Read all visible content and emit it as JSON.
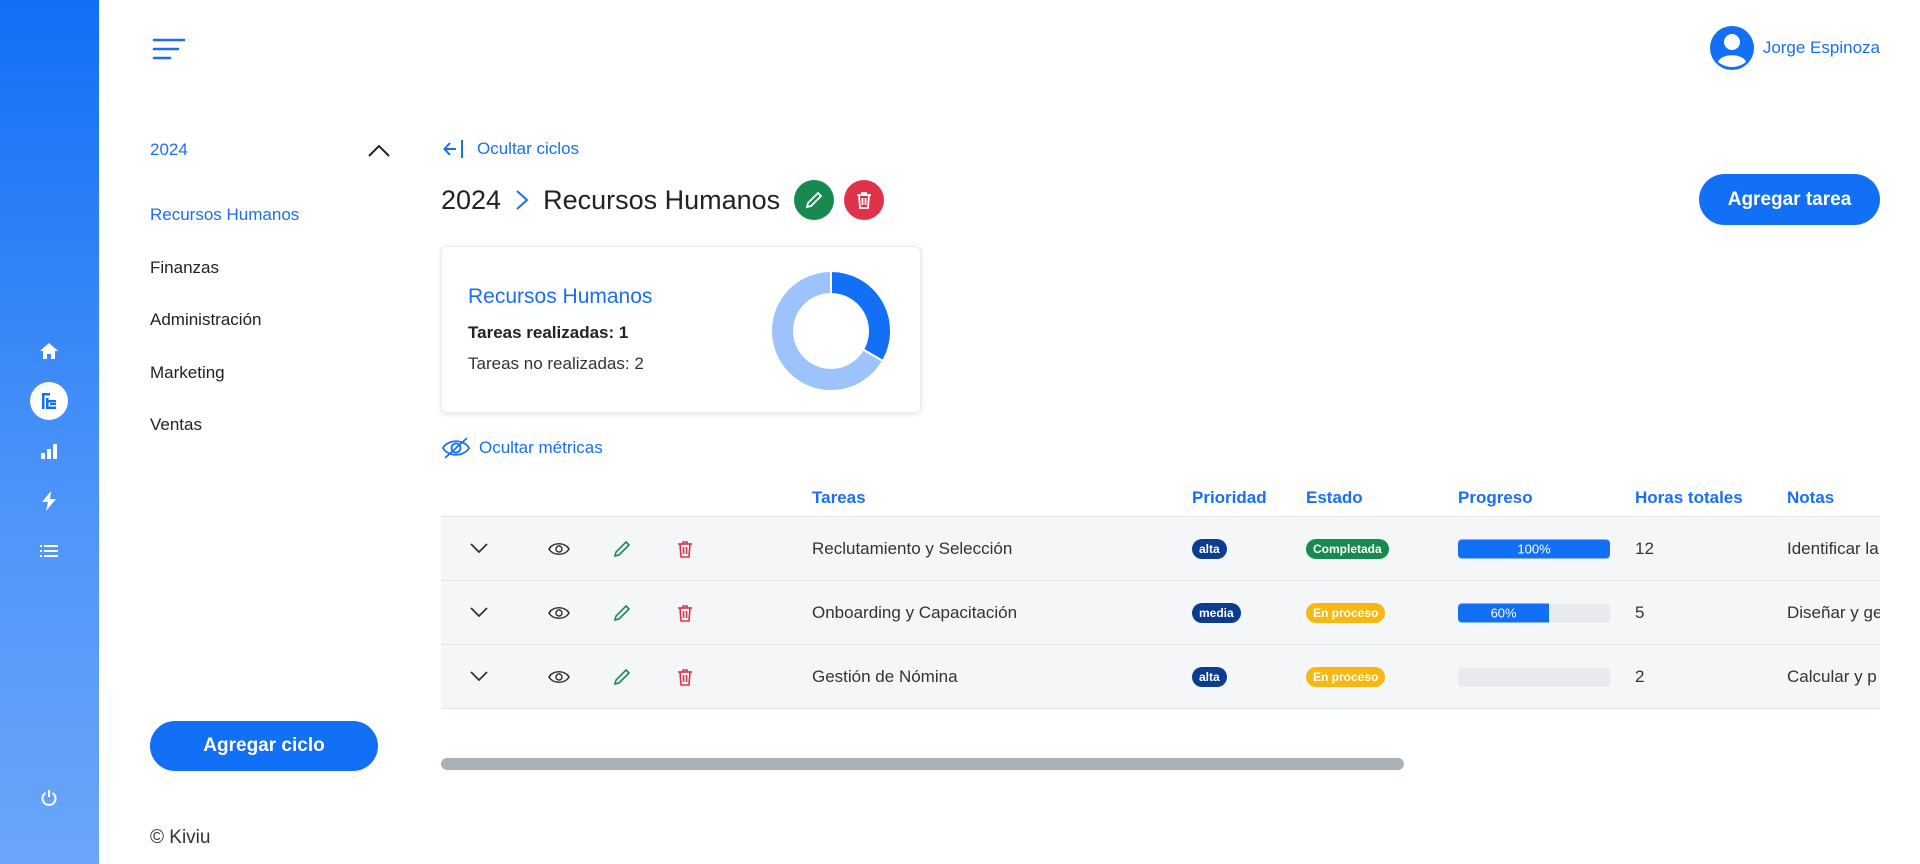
{
  "colors": {
    "primary": "#1170f6",
    "danger": "#e0334a",
    "success": "#198a4f",
    "warning": "#f7b814",
    "priority_high": "#0d3b8f"
  },
  "rail": {
    "icons": [
      "home-icon",
      "tree-icon",
      "chart-icon",
      "bolt-icon",
      "list-icon",
      "power-icon"
    ],
    "active": "tree-icon"
  },
  "header": {
    "user_name": "Jorge Espinoza"
  },
  "sidebar": {
    "year": "2024",
    "items": [
      {
        "label": "Recursos Humanos",
        "active": true
      },
      {
        "label": "Finanzas"
      },
      {
        "label": "Administración"
      },
      {
        "label": "Marketing"
      },
      {
        "label": "Ventas"
      }
    ],
    "add_cycle_label": "Agregar ciclo",
    "footer": "© Kiviu"
  },
  "main": {
    "hide_cycles_label": "Ocultar ciclos",
    "breadcrumb": {
      "year": "2024",
      "area": "Recursos Humanos"
    },
    "add_task_label": "Agregar tarea",
    "metrics_card": {
      "title": "Recursos Humanos",
      "done_label": "Tareas realizadas: 1",
      "not_done_label": "Tareas no realizadas: 2",
      "done": 1,
      "not_done": 2,
      "colors": {
        "done": "#1170f6",
        "not_done": "#9cc3fc"
      }
    },
    "hide_metrics_label": "Ocultar métricas"
  },
  "table": {
    "headers": {
      "task": "Tareas",
      "priority": "Prioridad",
      "status": "Estado",
      "progress": "Progreso",
      "hours": "Horas totales",
      "notes": "Notas"
    },
    "rows": [
      {
        "task": "Reclutamiento y Selección",
        "priority": "alta",
        "status": "Completada",
        "progress_label": "100%",
        "progress": 1.0,
        "hours": "12",
        "notes": "Identificar la"
      },
      {
        "task": "Onboarding y Capacitación",
        "priority": "media",
        "status": "En proceso",
        "progress_label": "60%",
        "progress": 0.6,
        "hours": "5",
        "notes": "Diseñar y ge"
      },
      {
        "task": "Gestión de Nómina",
        "priority": "alta",
        "status": "En proceso",
        "progress_label": "",
        "progress": 0,
        "hours": "2",
        "notes": "Calcular y p"
      }
    ]
  }
}
